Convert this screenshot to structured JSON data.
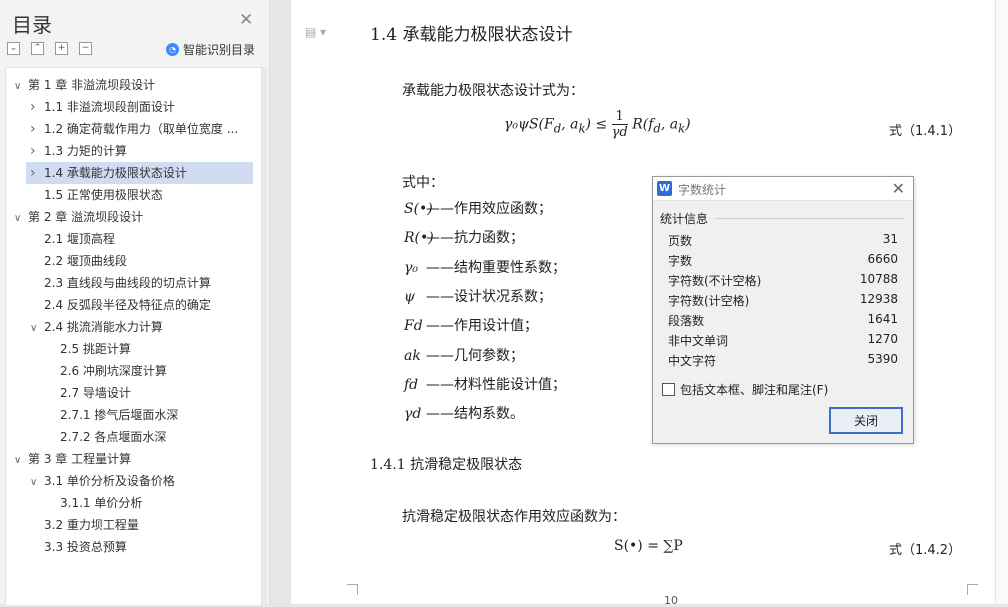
{
  "toc": {
    "title": "目录",
    "smart_label": "智能识别目录",
    "items": [
      {
        "label": "第 1 章  非溢流坝段设计",
        "level": 0,
        "arrow": "expanded"
      },
      {
        "label": "1.1 非溢流坝段剖面设计",
        "level": 1,
        "arrow": "collapsed"
      },
      {
        "label": "1.2 确定荷载作用力（取单位宽度 ...",
        "level": 1,
        "arrow": "collapsed"
      },
      {
        "label": "1.3 力矩的计算",
        "level": 1,
        "arrow": "collapsed"
      },
      {
        "label": "1.4 承载能力极限状态设计",
        "level": 1,
        "arrow": "collapsed",
        "selected": true
      },
      {
        "label": "1.5 正常使用极限状态",
        "level": 1,
        "arrow": "none"
      },
      {
        "label": "第 2 章  溢流坝段设计",
        "level": 0,
        "arrow": "expanded"
      },
      {
        "label": "2.1 堰顶高程",
        "level": 1,
        "arrow": "none"
      },
      {
        "label": "2.2 堰顶曲线段",
        "level": 1,
        "arrow": "none"
      },
      {
        "label": "2.3  直线段与曲线段的切点计算",
        "level": 1,
        "arrow": "none"
      },
      {
        "label": "2.4  反弧段半径及特征点的确定",
        "level": 1,
        "arrow": "none"
      },
      {
        "label": "2.4 挑流消能水力计算",
        "level": 1,
        "arrow": "expanded"
      },
      {
        "label": "2.5 挑距计算",
        "level": 2,
        "arrow": "none"
      },
      {
        "label": "2.6 冲刷坑深度计算",
        "level": 2,
        "arrow": "none"
      },
      {
        "label": "2.7 导墙设计",
        "level": 2,
        "arrow": "none"
      },
      {
        "label": "2.7.1 掺气后堰面水深",
        "level": 2,
        "arrow": "none"
      },
      {
        "label": "2.7.2 各点堰面水深",
        "level": 2,
        "arrow": "none"
      },
      {
        "label": "第 3 章  工程量计算",
        "level": 0,
        "arrow": "expanded"
      },
      {
        "label": "3.1  单价分析及设备价格",
        "level": 1,
        "arrow": "expanded"
      },
      {
        "label": "3.1.1  单价分析",
        "level": 2,
        "arrow": "none"
      },
      {
        "label": "3.2  重力坝工程量",
        "level": 1,
        "arrow": "none"
      },
      {
        "label": "3.3  投资总预算",
        "level": 1,
        "arrow": "none"
      }
    ]
  },
  "doc": {
    "heading": "1.4 承载能力极限状态设计",
    "intro": "承载能力极限状态设计式为：",
    "formula1": {
      "lhs": "γ₀ψS(F",
      "lhs_sub_d": "d",
      "lhs_mid": ", a",
      "lhs_sub_k": "k",
      "lhs_end": ") ≤",
      "frac_num": "1",
      "frac_den": "γd",
      "rhs": "R(f",
      "rhs_sub_d": "d",
      "rhs_mid": ", a",
      "rhs_sub_k": "k",
      "rhs_end": ")"
    },
    "eq1_label": "式（1.4.1）",
    "where": "式中：",
    "definitions": [
      {
        "sym": "S(•)",
        "text": "——作用效应函数；"
      },
      {
        "sym": "R(•)",
        "text": "——抗力函数；"
      },
      {
        "sym": "γ₀",
        "text": "——结构重要性系数；"
      },
      {
        "sym": "ψ",
        "text": "——设计状况系数；"
      },
      {
        "sym": "Fd",
        "text": "——作用设计值；"
      },
      {
        "sym": "ak",
        "text": "——几何参数；"
      },
      {
        "sym": "fd",
        "text": "——材料性能设计值；"
      },
      {
        "sym": "γd",
        "text": "——结构系数。"
      }
    ],
    "subheading": "1.4.1 抗滑稳定极限状态",
    "para2": "抗滑稳定极限状态作用效应函数为：",
    "formula2": "S(•) = ∑P",
    "eq2_label": "式（1.4.2）",
    "page_number": "10"
  },
  "dialog": {
    "title": "字数统计",
    "section": "统计信息",
    "stats": [
      {
        "label": "页数",
        "value": "31"
      },
      {
        "label": "字数",
        "value": "6660"
      },
      {
        "label": "字符数(不计空格)",
        "value": "10788"
      },
      {
        "label": "字符数(计空格)",
        "value": "12938"
      },
      {
        "label": "段落数",
        "value": "1641"
      },
      {
        "label": "非中文单词",
        "value": "1270"
      },
      {
        "label": "中文字符",
        "value": "5390"
      }
    ],
    "checkbox_label": "包括文本框、脚注和尾注(F)",
    "checkbox_checked": false,
    "close_button": "关闭"
  },
  "colors": {
    "accent": "#3c6ed0",
    "selection": "#cfdcf2",
    "wps_blue": "#2f6bd8"
  }
}
